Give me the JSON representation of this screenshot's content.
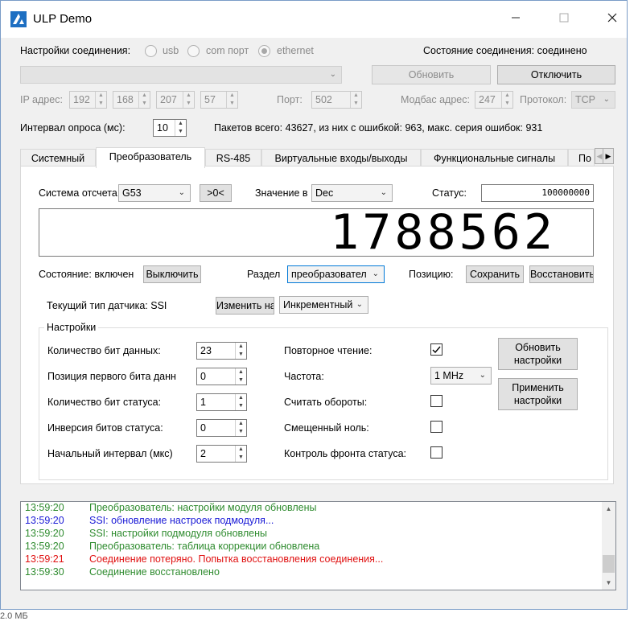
{
  "window": {
    "title": "ULP Demo"
  },
  "conn": {
    "settings_label": "Настройки соединения:",
    "radios": [
      "usb",
      "com порт",
      "ethernet"
    ],
    "state_label": "Состояние соединения: соединено",
    "refresh_btn": "Обновить",
    "disconnect_btn": "Отключить",
    "ip_label": "IP адрес:",
    "ip": [
      "192",
      "168",
      "207",
      "57"
    ],
    "port_label": "Порт:",
    "port": "502",
    "modbus_label": "Модбас адрес:",
    "modbus": "247",
    "proto_label": "Протокол:",
    "proto": "TCP",
    "interval_label": "Интервал опроса (мс):",
    "interval": "10",
    "stats": "Пакетов всего: 43627, из них с ошибкой: 963, макс. серия ошибок: 931"
  },
  "tabs": [
    "Системный",
    "Преобразователь",
    "RS-485",
    "Виртуальные входы/выходы",
    "Функциональные сигналы",
    "По"
  ],
  "conv": {
    "refsys_label": "Система отсчета",
    "refsys": "G53",
    "zero_btn": ">0<",
    "value_label": "Значение в",
    "value_fmt": "Dec",
    "status_label": "Статус:",
    "status_value": "100000000",
    "display": "1788562",
    "state_label": "Состояние: включен",
    "off_btn": "Выключить",
    "section_label": "Раздел",
    "section": "преобразовател",
    "pos_label": "Позицию:",
    "save_btn": "Сохранить",
    "restore_btn": "Восстановить",
    "sensor_label": "Текущий тип датчика: SSI",
    "change_btn": "Изменить на",
    "sensor_type": "Инкрементный"
  },
  "settings": {
    "legend": "Настройки",
    "left": [
      {
        "label": "Количество бит данных:",
        "value": "23"
      },
      {
        "label": "Позиция первого бита данных:",
        "value": "0"
      },
      {
        "label": "Количество бит статуса:",
        "value": "1"
      },
      {
        "label": "Инверсия битов статуса:",
        "value": "0"
      },
      {
        "label": "Начальный интервал (мкс)",
        "value": "2"
      }
    ],
    "right": [
      {
        "label": "Повторное чтение:",
        "checked": true
      },
      {
        "label": "Частота:",
        "combo": "1 MHz"
      },
      {
        "label": "Считать обороты:",
        "checked": false
      },
      {
        "label": "Смещенный ноль:",
        "checked": false
      },
      {
        "label": "Контроль фронта статуса:",
        "checked": false
      }
    ],
    "update_btn": [
      "Обновить",
      "настройки"
    ],
    "apply_btn": [
      "Применить",
      "настройки"
    ]
  },
  "log": [
    {
      "time": "13:59:20",
      "msg": "Преобразователь:  настройки модуля обновлены",
      "color": "#2e8b2e"
    },
    {
      "time": "13:59:20",
      "msg": "SSI:  обновление настроек подмодуля...",
      "color": "#1a1ad6"
    },
    {
      "time": "13:59:20",
      "msg": "SSI:  настройки подмодуля обновлены",
      "color": "#2e8b2e"
    },
    {
      "time": "13:59:20",
      "msg": "Преобразователь:  таблица коррекции обновлена",
      "color": "#2e8b2e"
    },
    {
      "time": "13:59:21",
      "msg": "Соединение потеряно. Попытка восстановления соединения...",
      "color": "#e01010"
    },
    {
      "time": "13:59:30",
      "msg": "Соединение восстановлено",
      "color": "#2e8b2e"
    }
  ],
  "background_text": "2.0 МБ"
}
